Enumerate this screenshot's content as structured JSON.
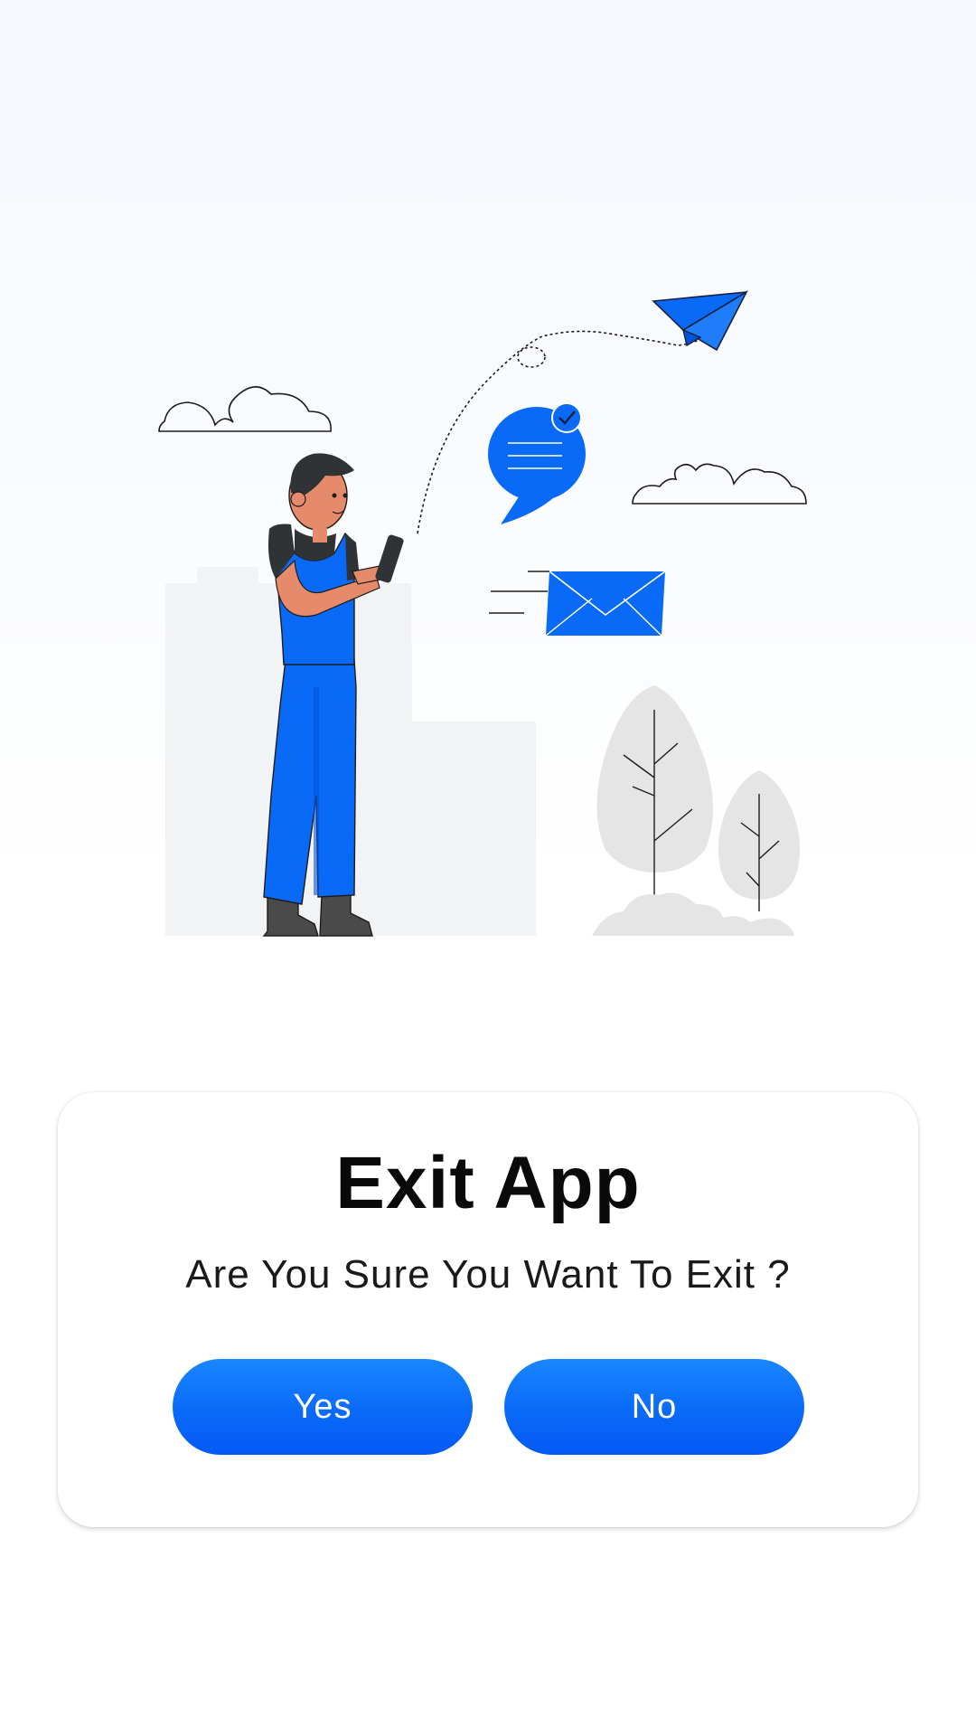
{
  "illustration": {
    "description_icons": [
      "person-with-phone",
      "paper-plane-icon",
      "chat-bubble-icon",
      "envelope-icon",
      "cloud-icon",
      "tree-icon",
      "building-silhouette"
    ],
    "accent_color": "#0a6af8"
  },
  "dialog": {
    "title": "Exit App",
    "message": "Are You Sure You Want To Exit ?",
    "yes_label": "Yes",
    "no_label": "No"
  },
  "colors": {
    "button_primary": "#0a6af8",
    "title_text": "#0a0a0a",
    "background": "#f5f8fd"
  }
}
